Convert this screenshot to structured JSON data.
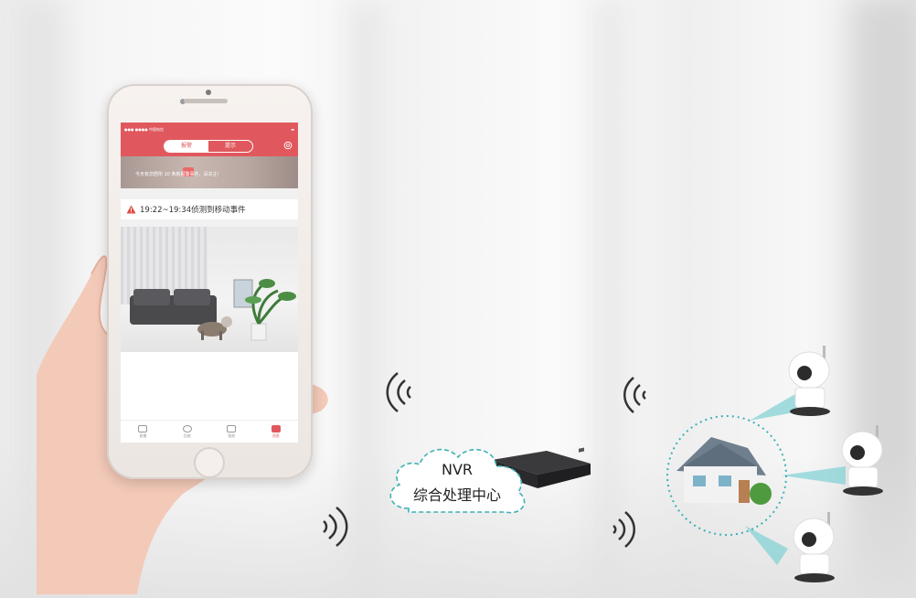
{
  "phone_app": {
    "status_bar": {
      "left": "●●● ●●●● 中国电信",
      "right": "▬"
    },
    "tabs_top": [
      "报警",
      "提示"
    ],
    "active_top_tab": 0,
    "banner_text": "今天有您居所  10  条新报警事件，请关注！",
    "banner_count": "10",
    "alert": {
      "icon": "warning-icon",
      "text": "19:22~19:34侦测到移动事件"
    },
    "bottom_tabs": [
      {
        "label": "直播",
        "icon": "video-icon"
      },
      {
        "label": "回放",
        "icon": "playback-icon"
      },
      {
        "label": "相册",
        "icon": "album-icon"
      },
      {
        "label": "消息",
        "icon": "message-icon"
      }
    ],
    "active_bottom_tab": 3
  },
  "cloud": {
    "title": "NVR",
    "subtitle": "综合处理中心"
  },
  "colors": {
    "accent": "#e0585d",
    "teal": "#3fb1b4",
    "warning": "#e14b44"
  }
}
